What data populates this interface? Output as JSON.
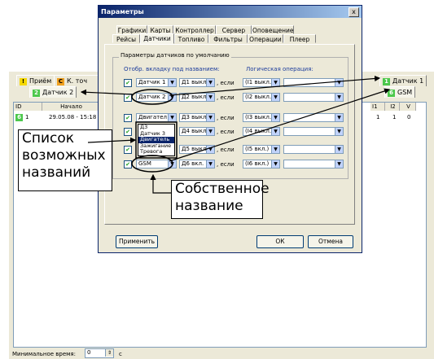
{
  "background": {
    "tabs_row1": [
      "Приём",
      "К. точ",
      "Датчик 1"
    ],
    "tabs_row2_left": "Датчик 2",
    "tab_row2_right": "GSM",
    "left_table": {
      "columns": [
        "ID",
        "Начало"
      ],
      "row": {
        "id": "1",
        "start": "29.05.08 - 15:18"
      }
    },
    "right_table": {
      "columns": [
        "I1",
        "I2",
        "V"
      ],
      "row": [
        "1",
        "1",
        "0"
      ]
    },
    "min_time_label": "Минимальное время:",
    "min_time_value": "0",
    "min_time_unit": "с"
  },
  "dialog": {
    "title": "Параметры",
    "close": "x",
    "tabs_row1": [
      "Графики",
      "Карты",
      "Контроллер",
      "Сервер",
      "Оповещение"
    ],
    "tabs_row2": [
      "Рейсы",
      "Датчики",
      "Топливо",
      "Фильтры",
      "Операции",
      "Плеер"
    ],
    "group_title": "Параметры датчиков по умолчанию",
    "col_header_display": "Отобр. вкладку под названием:",
    "col_header_logic": "Логическая операция:",
    "if_text": ", если",
    "rows": [
      {
        "name": "Датчик 1",
        "sensor": "Д1 выкл.",
        "condition": "(I1 выкл.)"
      },
      {
        "name": "Датчик 2",
        "sensor": "Д2 выкл.",
        "condition": "(I2 выкл.)"
      },
      {
        "name": "Двигател",
        "sensor": "Д3 выкл.",
        "condition": "(I3 выкл.)"
      },
      {
        "name": "",
        "sensor": "Д4 выкл.",
        "condition": "(I4 выкл.)"
      },
      {
        "name": "",
        "sensor": "Д5 выкл.",
        "condition": "(I5 вкл.)"
      },
      {
        "name": "GSM",
        "sensor": "Д6 вкл.",
        "condition": "(I6 вкл.)"
      }
    ],
    "dropdown_options": [
      "Д3",
      "Датчик 3",
      "Двигатель",
      "Зажигание",
      "Тревога"
    ],
    "dropdown_selected_index": 2,
    "apply": "Применить",
    "ok": "ОК",
    "cancel": "Отмена"
  },
  "callouts": {
    "list_of_names": "Список возможных названий",
    "own_name": "Собственное название"
  }
}
